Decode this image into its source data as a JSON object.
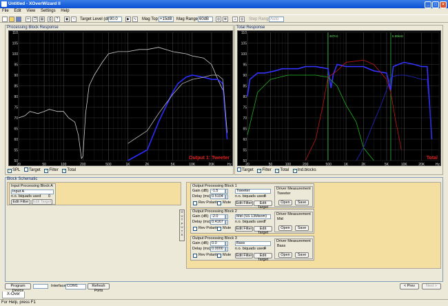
{
  "window": {
    "title": "Untitled - XOverWizard II"
  },
  "menu": [
    "File",
    "Edit",
    "View",
    "Settings",
    "Help"
  ],
  "toolbar": {
    "target_level_label": "Target Level (dB)",
    "target_level_value": "90.0",
    "mag_top_label": "Mag Top",
    "mag_top_value": "+15dB",
    "mag_range_label": "Mag Range",
    "mag_range_value": "60dB",
    "step_range_label": "Step Range",
    "step_range_value": "Auto"
  },
  "left_plot": {
    "title": "Processing Block Response",
    "overlay": "Output 1: Tweeter",
    "checks": [
      {
        "label": "SPL",
        "checked": true
      },
      {
        "label": "Target",
        "checked": false
      },
      {
        "label": "Filter",
        "checked": true
      },
      {
        "label": "Total",
        "checked": true
      }
    ]
  },
  "right_plot": {
    "title": "Total Response",
    "overlay": "Total",
    "marker1": "487Hz",
    "marker2": "5.89kHz",
    "checks": [
      {
        "label": "Target",
        "checked": false
      },
      {
        "label": "Filter",
        "checked": true
      },
      {
        "label": "Total",
        "checked": true
      },
      {
        "label": "Ind.blocks",
        "checked": true
      }
    ]
  },
  "axes": {
    "y": [
      "110",
      "105",
      "100",
      "95",
      "90",
      "85",
      "80",
      "75",
      "70",
      "65",
      "60",
      "55",
      "50"
    ],
    "x": [
      "20",
      "50",
      "100",
      "200",
      "500",
      "1K",
      "2K",
      "5K",
      "10K",
      "20K",
      "Hz"
    ]
  },
  "chart_data": [
    {
      "type": "line",
      "title": "Processing Block Response",
      "xscale": "log",
      "xlim": [
        20,
        40000
      ],
      "ylim": [
        50,
        110
      ],
      "ylabel": "dB",
      "series": [
        {
          "color": "#d0d0d0",
          "x": [
            20,
            25,
            30,
            40,
            50,
            60,
            80,
            100,
            120,
            150,
            170,
            190,
            200,
            220,
            250,
            300,
            400,
            500,
            700,
            1000,
            1500,
            2000,
            3000,
            5000,
            8000,
            10000,
            15000,
            20000,
            25000,
            30000
          ],
          "y": [
            70,
            71,
            73,
            72,
            73,
            74,
            73,
            73,
            70,
            68,
            62,
            51,
            52,
            72,
            85,
            90,
            96,
            100,
            101,
            101,
            102,
            102,
            103,
            101,
            100,
            99,
            98,
            95,
            88,
            83
          ]
        },
        {
          "color": "#2c2cff",
          "x": [
            1000,
            2000,
            3000,
            4000,
            5000,
            6000,
            8000,
            10000,
            15000,
            20000,
            25000,
            30000,
            35000
          ],
          "y": [
            50,
            55,
            68,
            76,
            82,
            86,
            89,
            90,
            89,
            88,
            88,
            86,
            60
          ]
        },
        {
          "color": "#c0c0c0",
          "x": [
            1000,
            2000,
            3000,
            5000,
            7000,
            10000,
            15000,
            20000,
            25000,
            30000,
            35000
          ],
          "y": [
            58,
            64,
            72,
            81,
            86,
            88,
            89,
            90,
            90,
            88,
            63
          ]
        }
      ]
    },
    {
      "type": "line",
      "title": "Total Response",
      "xscale": "log",
      "xlim": [
        20,
        40000
      ],
      "ylim": [
        50,
        110
      ],
      "ylabel": "dB",
      "series": [
        {
          "name": "Total",
          "color": "#3333ff",
          "x": [
            20,
            22,
            30,
            40,
            60,
            80,
            100,
            150,
            200,
            300,
            487,
            550,
            600,
            700,
            1000,
            2000,
            3000,
            5000,
            5890,
            6500,
            8000,
            10000,
            15000,
            20000,
            25000,
            30000
          ],
          "y": [
            80,
            88,
            91,
            91,
            92,
            93,
            93,
            93,
            94,
            94,
            93,
            84,
            90,
            95,
            94,
            94,
            92,
            91,
            83,
            94,
            95,
            96,
            95,
            94,
            94,
            60
          ]
        },
        {
          "name": "Bass",
          "color": "#21b121",
          "x": [
            20,
            30,
            50,
            100,
            200,
            300,
            487,
            700,
            1000,
            1500,
            2000,
            3000
          ],
          "y": [
            62,
            82,
            88,
            90,
            90,
            90,
            89,
            85,
            76,
            68,
            56,
            50
          ]
        },
        {
          "name": "Mid",
          "color": "#c01818",
          "x": [
            200,
            300,
            400,
            487,
            700,
            1000,
            2000,
            3000,
            5000,
            5890,
            7000,
            9000
          ],
          "y": [
            50,
            60,
            76,
            89,
            92,
            96,
            97,
            95,
            88,
            82,
            70,
            55
          ]
        },
        {
          "name": "Tweeter",
          "color": "#2626c8",
          "x": [
            1500,
            2000,
            3000,
            4000,
            5000,
            5890,
            8000,
            10000,
            15000,
            20000,
            25000,
            30000
          ],
          "y": [
            50,
            56,
            68,
            76,
            83,
            89,
            90,
            90,
            89,
            88,
            88,
            62
          ]
        }
      ]
    }
  ],
  "schematic": {
    "title": "Block Schematic",
    "input_block": {
      "title": "Input Processing Block A",
      "name": "Input A",
      "biquads_label": "n.o. biquads used",
      "biquads_value": "0",
      "edit_filter": "Edit Filter",
      "edit_target": "Edit Target"
    },
    "outputs": [
      {
        "title": "Output Processing Block 1",
        "gain": "-1.5",
        "delay": "0.5104",
        "name": "Tweeter",
        "biquads": "4",
        "driver": "Tweeter"
      },
      {
        "title": "Output Processing Block 2",
        "gain": "-2.0",
        "delay": "0.4167",
        "name": "Mid (SS 13Msom)",
        "biquads": "7",
        "driver": "Mid"
      },
      {
        "title": "Output Processing Block 3",
        "gain": "0.0",
        "delay": "0.0000",
        "name": "Bass",
        "biquads": "4",
        "driver": "Bass"
      }
    ],
    "labels": {
      "gain": "Gain (dB)",
      "delay": "Delay (ms)",
      "rev": "Rev Polarity",
      "mute": "Mute",
      "biquads": "n.o. biquads used",
      "edit_filter": "Edit Filter",
      "edit_target": "Edit Target",
      "driver_meas": "Driver Measurement",
      "open": "Open",
      "save": "Save"
    },
    "side_label": "OUTPUTS"
  },
  "bottom": {
    "program": "Program Device",
    "interface_label": "Interface",
    "interface_value": "COM1",
    "refresh": "Refresh Ports",
    "prev": "< Prev",
    "next": "Next >"
  },
  "tab": "X-Over",
  "status": "For Help, press F1"
}
